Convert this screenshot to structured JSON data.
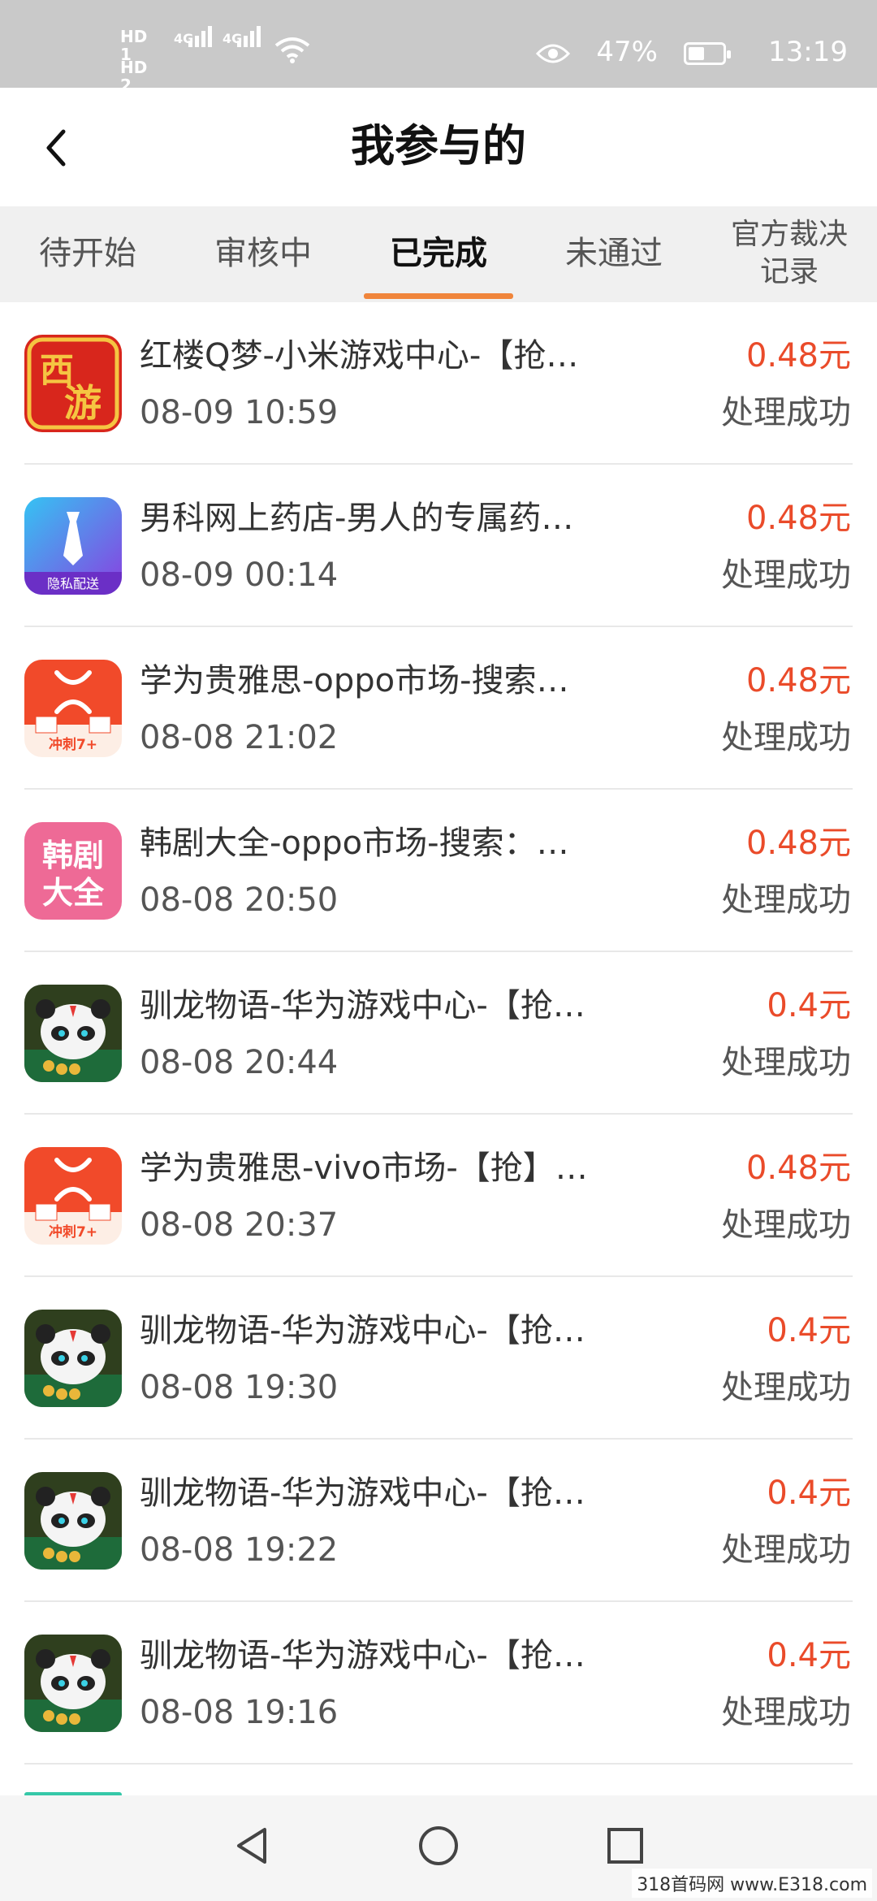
{
  "status_bar": {
    "sim1": "HD 1",
    "sim2": "HD 2",
    "net1": "4G",
    "net2": "4G",
    "battery": "47%",
    "battery_level": 0.47,
    "time": "13:19",
    "icons": [
      "signal-icon",
      "wifi-icon",
      "eye-icon",
      "battery-icon"
    ]
  },
  "header": {
    "title": "我参与的",
    "back_icon": "chevron-left-icon"
  },
  "tabs": [
    {
      "label": "待开始",
      "active": false
    },
    {
      "label": "审核中",
      "active": false
    },
    {
      "label": "已完成",
      "active": true
    },
    {
      "label": "未通过",
      "active": false
    },
    {
      "label": "官方裁决\n记录",
      "active": false
    }
  ],
  "accent_color": "#f0853b",
  "amount_color": "#ea4b2a",
  "records": [
    {
      "icon": "xiyou-app-icon",
      "icon_text": [
        "西",
        "游"
      ],
      "name": "红楼Q梦-小米游戏中心-【抢…",
      "time": "08-09 10:59",
      "amount": "0.48元",
      "status": "处理成功"
    },
    {
      "icon": "nanke-app-icon",
      "icon_text": [
        "隐私配送"
      ],
      "name": "男科网上药店-男人的专属药…",
      "time": "08-09 00:14",
      "amount": "0.48元",
      "status": "处理成功"
    },
    {
      "icon": "xuewei-app-icon",
      "icon_text": [
        "冲刺7+"
      ],
      "name": "学为贵雅思-oppo市场-搜索…",
      "time": "08-08 21:02",
      "amount": "0.48元",
      "status": "处理成功"
    },
    {
      "icon": "hanju-app-icon",
      "icon_text": [
        "韩剧",
        "大全"
      ],
      "name": "韩剧大全-oppo市场-搜索：…",
      "time": "08-08 20:50",
      "amount": "0.48元",
      "status": "处理成功"
    },
    {
      "icon": "xunlong-app-icon",
      "icon_text": [],
      "name": "驯龙物语-华为游戏中心-【抢…",
      "time": "08-08 20:44",
      "amount": "0.4元",
      "status": "处理成功"
    },
    {
      "icon": "xuewei-app-icon",
      "icon_text": [
        "冲刺7+"
      ],
      "name": "学为贵雅思-vivo市场-【抢】…",
      "time": "08-08 20:37",
      "amount": "0.48元",
      "status": "处理成功"
    },
    {
      "icon": "xunlong-app-icon",
      "icon_text": [],
      "name": "驯龙物语-华为游戏中心-【抢…",
      "time": "08-08 19:30",
      "amount": "0.4元",
      "status": "处理成功"
    },
    {
      "icon": "xunlong-app-icon",
      "icon_text": [],
      "name": "驯龙物语-华为游戏中心-【抢…",
      "time": "08-08 19:22",
      "amount": "0.4元",
      "status": "处理成功"
    },
    {
      "icon": "xunlong-app-icon",
      "icon_text": [],
      "name": "驯龙物语-华为游戏中心-【抢…",
      "time": "08-08 19:16",
      "amount": "0.4元",
      "status": "处理成功"
    }
  ],
  "nav_bar": {
    "buttons": [
      "back-triangle-icon",
      "home-circle-icon",
      "recents-square-icon"
    ]
  },
  "watermark": "318首码网 www.E318.com"
}
